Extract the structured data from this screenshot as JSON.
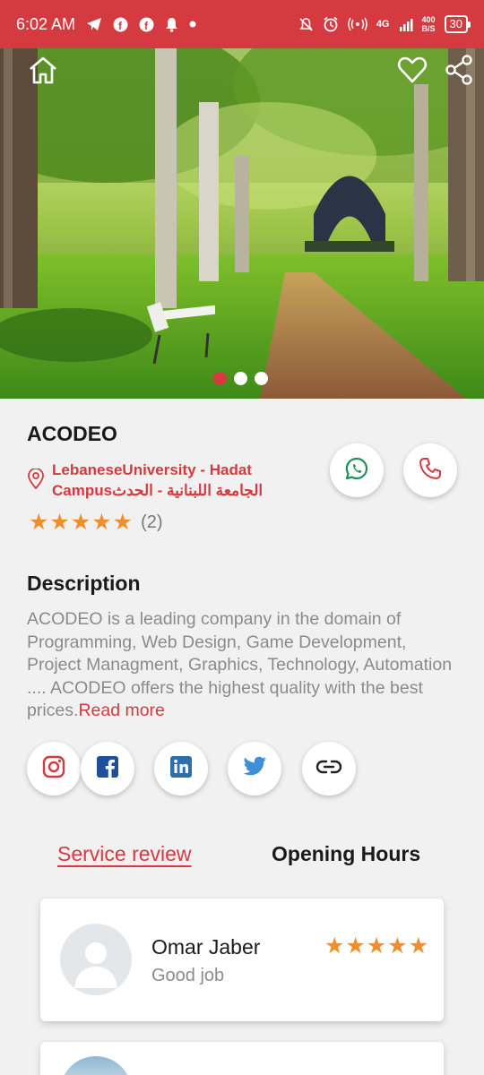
{
  "status_bar": {
    "time": "6:02 AM",
    "network": "4G",
    "speed_value": "400",
    "speed_unit": "B/S",
    "battery": "30",
    "icons": [
      "telegram-icon",
      "facebook-icon",
      "facebook-icon",
      "notification-icon",
      "dot-icon",
      "mute-icon",
      "alarm-icon",
      "hotspot-icon",
      "signal-icon"
    ]
  },
  "hero": {
    "slides_total": 3,
    "active_slide": 1,
    "icons": [
      "home-icon",
      "heart-icon",
      "share-icon"
    ]
  },
  "business": {
    "name": "ACODEO",
    "location_line1": "LebaneseUniversity - Hadat",
    "location_line2": "Campusالجامعة اللبنانية - الحدث",
    "rating_stars": "★★★★★",
    "rating_value": 5,
    "rating_count": "(2)"
  },
  "description": {
    "heading": "Description",
    "text": "ACODEO is a leading company in the domain of Programming, Web Design, Game Development, Project Managment, Graphics, Technology, Automation .... ACODEO offers the highest quality with the best prices.",
    "read_more": "Read more"
  },
  "social_links": [
    "instagram-icon",
    "facebook-icon",
    "linkedin-icon",
    "twitter-icon",
    "link-icon"
  ],
  "contact_buttons": [
    "whatsapp-icon",
    "phone-icon"
  ],
  "tabs": {
    "service_review": "Service review",
    "opening_hours": "Opening Hours"
  },
  "reviews": [
    {
      "name": "Omar Jaber",
      "comment": "Good job",
      "stars": "★★★★★",
      "rating": 5
    }
  ],
  "colors": {
    "accent": "#d43a3f",
    "star": "#ef8f2b",
    "facebook": "#1e4f9c",
    "linkedin": "#2d6fab",
    "twitter": "#3d8fd6",
    "whatsapp": "#1f8f5a"
  }
}
